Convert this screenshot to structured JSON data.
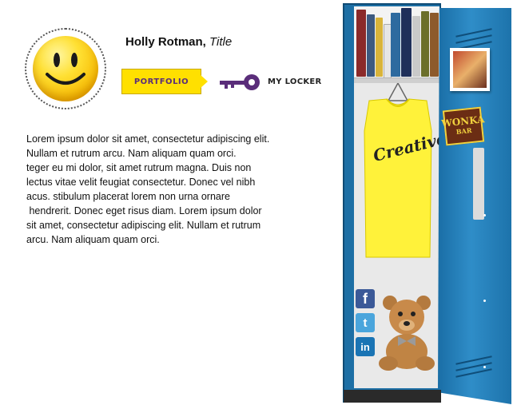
{
  "profile": {
    "name": "Holly Rotman,",
    "title": "Title"
  },
  "nav": {
    "portfolio_label": "PORTFOLIO",
    "locker_label": "MY LOCKER"
  },
  "bio": {
    "lines": [
      "Lorem ipsum dolor sit amet, consectetur adipiscing elit.",
      "Nullam et rutrum arcu. Nam aliquam quam orci.",
      "teger eu mi dolor, sit amet rutrum magna. Duis non",
      "lectus vitae velit feugiat consectetur. Donec vel nibh",
      "acus. stibulum placerat lorem non urna ornare",
      " hendrerit. Donec eget risus diam. Lorem ipsum dolor",
      "sit amet, consectetur adipiscing elit. Nullam et rutrum",
      "arcu. Nam aliquam quam orci."
    ]
  },
  "locker": {
    "shirt_text": "Creative",
    "sticker_line1": "WONKA",
    "sticker_line2": "BAR",
    "social": {
      "facebook": "f",
      "twitter": "t",
      "linkedin": "in"
    },
    "icons": [
      "key-icon",
      "smiley-avatar",
      "facebook-icon",
      "twitter-icon",
      "linkedin-icon",
      "teddy-bear",
      "yellow-tshirt",
      "photo-sticker",
      "wonka-sticker"
    ]
  },
  "colors": {
    "accent_yellow": "#ffe000",
    "key_purple": "#5a2d7a",
    "locker_blue": "#1d6fa5"
  }
}
